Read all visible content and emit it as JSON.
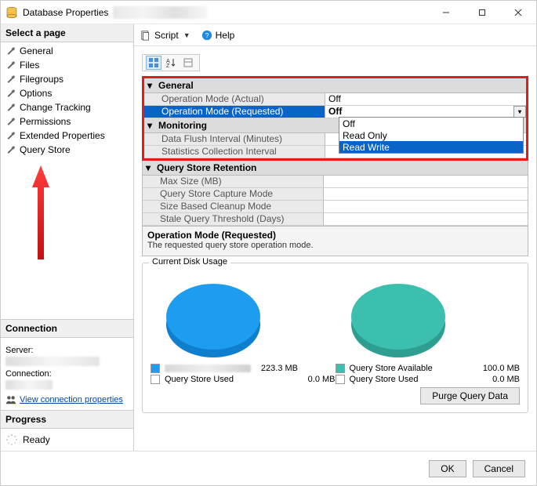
{
  "titlebar": {
    "title": "Database Properties"
  },
  "sidebar": {
    "header": "Select a page",
    "items": [
      {
        "label": "General"
      },
      {
        "label": "Files"
      },
      {
        "label": "Filegroups"
      },
      {
        "label": "Options"
      },
      {
        "label": "Change Tracking"
      },
      {
        "label": "Permissions"
      },
      {
        "label": "Extended Properties"
      },
      {
        "label": "Query Store"
      }
    ]
  },
  "connection": {
    "header": "Connection",
    "server_label": "Server:",
    "connection_label": "Connection:",
    "view_link": "View connection properties"
  },
  "progress": {
    "header": "Progress",
    "status": "Ready"
  },
  "toolbar": {
    "script_label": "Script",
    "help_label": "Help"
  },
  "grid": {
    "cat_general": "General",
    "op_mode_actual_label": "Operation Mode (Actual)",
    "op_mode_actual_value": "Off",
    "op_mode_req_label": "Operation Mode (Requested)",
    "op_mode_req_value": "Off",
    "cat_monitoring": "Monitoring",
    "data_flush_label": "Data Flush Interval (Minutes)",
    "stats_interval_label": "Statistics Collection Interval",
    "dropdown_options": [
      "Off",
      "Read Only",
      "Read Write"
    ],
    "cat_retention": "Query Store Retention",
    "max_size_label": "Max Size (MB)",
    "capture_mode_label": "Query Store Capture Mode",
    "cleanup_label": "Size Based Cleanup Mode",
    "stale_label": "Stale Query Threshold (Days)"
  },
  "description": {
    "title": "Operation Mode (Requested)",
    "text": "The requested query store operation mode."
  },
  "disk": {
    "group_title": "Current Disk Usage",
    "left": {
      "row1_value": "223.3 MB",
      "row2_label": "Query Store Used",
      "row2_value": "0.0 MB"
    },
    "right": {
      "row1_label": "Query Store Available",
      "row1_value": "100.0 MB",
      "row2_label": "Query Store Used",
      "row2_value": "0.0 MB"
    },
    "purge_label": "Purge Query Data"
  },
  "footer": {
    "ok": "OK",
    "cancel": "Cancel"
  },
  "colors": {
    "blue_accent": "#0a64c8",
    "pie_left": "#1e9cf0",
    "pie_right": "#3cbfae",
    "red_outline": "#e21b1b"
  },
  "chart_data": [
    {
      "type": "pie",
      "title": "Disk Usage (Database)",
      "series": [
        {
          "name": "(unlabeled)",
          "value": 223.3,
          "unit": "MB",
          "color": "#1e9cf0"
        },
        {
          "name": "Query Store Used",
          "value": 0.0,
          "unit": "MB",
          "color": "#ffffff"
        }
      ]
    },
    {
      "type": "pie",
      "title": "Disk Usage (Query Store)",
      "series": [
        {
          "name": "Query Store Available",
          "value": 100.0,
          "unit": "MB",
          "color": "#3cbfae"
        },
        {
          "name": "Query Store Used",
          "value": 0.0,
          "unit": "MB",
          "color": "#ffffff"
        }
      ]
    }
  ]
}
